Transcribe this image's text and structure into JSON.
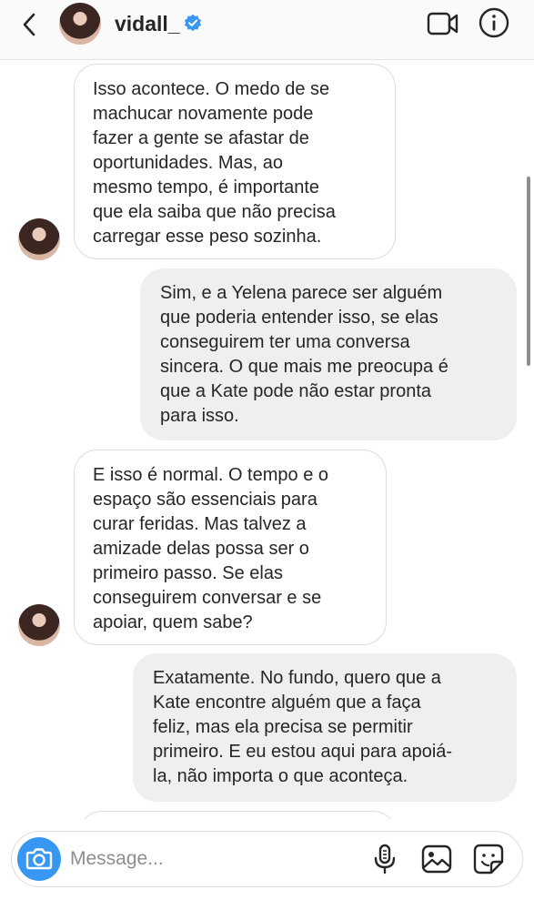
{
  "header": {
    "username": "vidall_",
    "icons": [
      "back-icon",
      "verified-badge-icon",
      "video-call-icon",
      "info-icon"
    ]
  },
  "messages": [
    {
      "direction": "incoming",
      "text": "Isso acontece. O medo de se\nmachucar novamente pode\nfazer a gente se afastar de\noportunidades. Mas, ao\nmesmo tempo, é importante\nque ela saiba que não precisa\ncarregar esse peso sozinha."
    },
    {
      "direction": "outgoing",
      "text": "Sim, e a Yelena parece ser alguém\nque poderia entender isso, se elas\nconseguirem ter uma conversa\nsincera. O que mais me preocupa é\nque a Kate pode não estar pronta\npara isso."
    },
    {
      "direction": "incoming",
      "text": "E isso é normal. O tempo e o\nespaço são essenciais para\ncurar feridas. Mas talvez a\namizade delas possa ser o\nprimeiro passo. Se elas\nconseguirem conversar e se\napoiar, quem sabe?"
    },
    {
      "direction": "outgoing",
      "text": "Exatamente. No fundo, quero que a\nKate encontre alguém que a faça\nfeliz, mas ela precisa se permitir\nprimeiro. E eu estou aqui para apoiá-\nla, não importa o que aconteça."
    }
  ],
  "composer": {
    "placeholder": "Message...",
    "value": "",
    "icons": [
      "camera-icon",
      "microphone-icon",
      "gallery-icon",
      "sticker-icon"
    ]
  },
  "colors": {
    "accent": "#3897f0",
    "verified": "#3897f0",
    "incoming_bubble": "#ffffff",
    "outgoing_bubble": "#efefef",
    "text": "#262626",
    "placeholder": "#8e8e8e"
  }
}
